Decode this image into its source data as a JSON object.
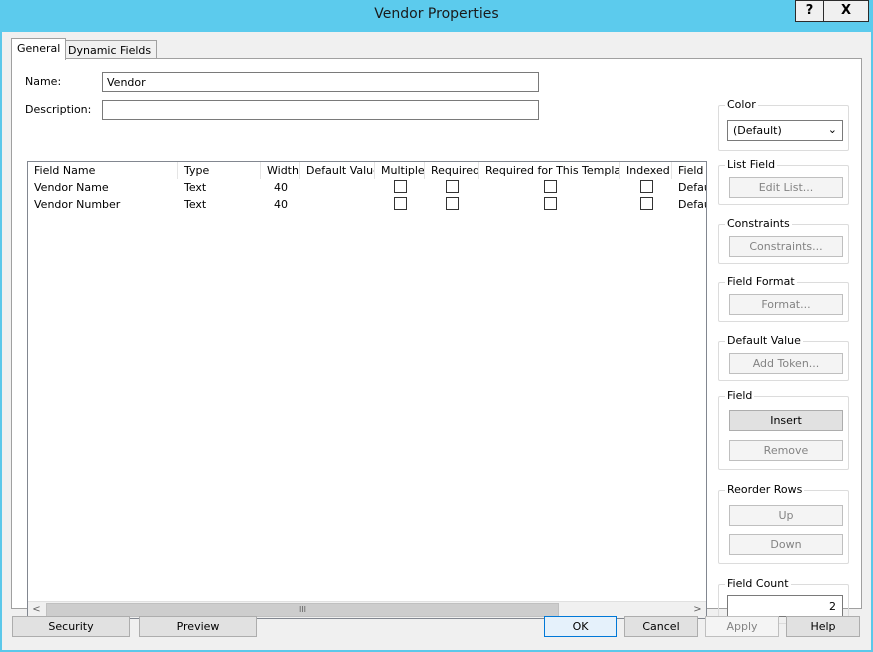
{
  "window": {
    "title": "Vendor Properties",
    "help": "?",
    "close": "X"
  },
  "tabs": [
    "General",
    "Dynamic Fields"
  ],
  "form": {
    "name_label": "Name:",
    "name_value": "Vendor",
    "description_label": "Description:",
    "description_value": ""
  },
  "grid": {
    "columns": [
      "Field Name",
      "Type",
      "Width",
      "Default Value",
      "Multiple",
      "Required",
      "Required for This Template",
      "Indexed",
      "Field I"
    ],
    "rows": [
      {
        "field_name": "Vendor Name",
        "type": "Text",
        "width": "40",
        "default_value": "",
        "multiple": false,
        "required": false,
        "required_template": false,
        "indexed": false,
        "field_i": "Defau"
      },
      {
        "field_name": "Vendor Number",
        "type": "Text",
        "width": "40",
        "default_value": "",
        "multiple": false,
        "required": false,
        "required_template": false,
        "indexed": false,
        "field_i": "Defau"
      }
    ],
    "scroll_left": "<",
    "scroll_right": ">",
    "scroll_grip": "III"
  },
  "side": {
    "color": {
      "title": "Color",
      "selected": "(Default)",
      "arrow": "⌄"
    },
    "list_field": {
      "title": "List Field",
      "button": "Edit List..."
    },
    "constraints": {
      "title": "Constraints",
      "button": "Constraints..."
    },
    "field_format": {
      "title": "Field Format",
      "button": "Format..."
    },
    "default_value": {
      "title": "Default Value",
      "button": "Add Token..."
    },
    "field": {
      "title": "Field",
      "insert": "Insert",
      "remove": "Remove"
    },
    "reorder": {
      "title": "Reorder Rows",
      "up": "Up",
      "down": "Down"
    },
    "field_count": {
      "title": "Field Count",
      "value": "2"
    }
  },
  "footer": {
    "security": "Security",
    "preview": "Preview",
    "ok": "OK",
    "cancel": "Cancel",
    "apply": "Apply",
    "help": "Help"
  }
}
